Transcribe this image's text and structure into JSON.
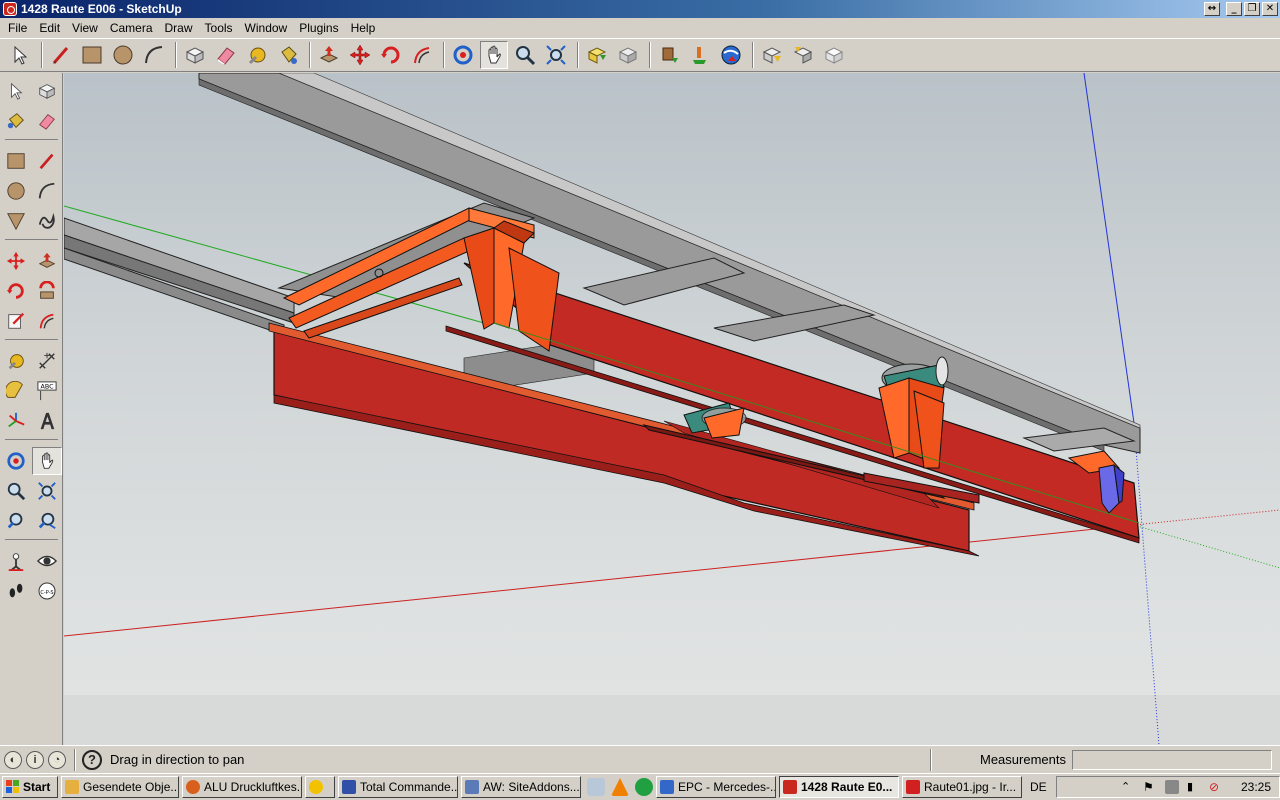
{
  "window": {
    "title": "1428 Raute E006 - SketchUp",
    "app_icon": "sketchup-icon",
    "controls": [
      "restore-icon",
      "minimize-icon",
      "maximize-icon",
      "close-icon"
    ]
  },
  "menu": {
    "items": [
      "File",
      "Edit",
      "View",
      "Camera",
      "Draw",
      "Tools",
      "Window",
      "Plugins",
      "Help"
    ]
  },
  "toolbar": {
    "tools": [
      "select-icon",
      "line-icon",
      "rectangle-icon",
      "circle-icon",
      "arc-icon",
      "make-component-icon",
      "eraser-icon",
      "tape-measure-icon",
      "paint-bucket-icon",
      "push-pull-icon",
      "move-icon",
      "rotate-icon",
      "offset-icon",
      "orbit-icon",
      "pan-icon",
      "zoom-icon",
      "zoom-extents-icon",
      "get-models-icon",
      "share-model-icon",
      "get-components-icon",
      "share-component-icon",
      "google-earth-icon",
      "previous-view-icon",
      "next-view-icon",
      "standard-views-icon"
    ],
    "active_tool": "pan-icon"
  },
  "left_toolbar": {
    "tools": [
      "select-icon",
      "make-component-icon",
      "paint-bucket-icon",
      "eraser-icon",
      "rectangle-icon",
      "line-icon",
      "circle-icon",
      "arc-icon",
      "polygon-icon",
      "freehand-icon",
      "move-icon",
      "push-pull-icon",
      "rotate-icon",
      "follow-me-icon",
      "scale-icon",
      "offset-icon",
      "tape-measure-icon",
      "dimension-icon",
      "protractor-icon",
      "text-icon",
      "axes-icon",
      "3d-text-icon",
      "orbit-icon",
      "pan-icon",
      "zoom-icon",
      "zoom-window-icon",
      "previous-view-icon",
      "zoom-extents-icon",
      "position-camera-icon",
      "look-around-icon",
      "walk-icon",
      "section-plane-icon"
    ],
    "section_text": "ABC",
    "section_label": "C-P-S"
  },
  "statusbar": {
    "icons": [
      "geo-location-icon",
      "credits-icon",
      "user-account-icon"
    ],
    "help_icon": "help-icon",
    "help_glyph": "?",
    "message": "Drag in direction to pan",
    "measurements_label": "Measurements",
    "measurements_value": ""
  },
  "taskbar": {
    "start_label": "Start",
    "tasks": [
      {
        "label": "Gesendete Obje...",
        "icon": "outlook-icon",
        "color": "#e6b040"
      },
      {
        "label": "ALU Druckluftkes...",
        "icon": "firefox-icon",
        "color": "#d8601c"
      },
      {
        "label": "",
        "icon": "norton-icon",
        "color": "#f2c200"
      },
      {
        "label": "Total Commande...",
        "icon": "total-commander-icon",
        "color": "#3050a8"
      },
      {
        "label": "AW: SiteAddons....",
        "icon": "mail-icon",
        "color": "#5a7ab8"
      },
      {
        "label": "",
        "icon": "notepad-icon",
        "color": "#b8c8d8"
      },
      {
        "label": "",
        "icon": "vlc-icon",
        "color": "#f08000"
      },
      {
        "label": "",
        "icon": "skype-icon",
        "color": "#20a040"
      },
      {
        "label": "EPC - Mercedes-...",
        "icon": "epc-icon",
        "color": "#3468c8"
      },
      {
        "label": "1428 Raute E0...",
        "icon": "sketchup-icon",
        "color": "#c8281e",
        "active": true
      },
      {
        "label": "Raute01.jpg - Ir...",
        "icon": "irfanview-icon",
        "color": "#d02020"
      }
    ],
    "language": "DE",
    "tray_icons": [
      "chevron-up-icon",
      "flag-icon",
      "printer-icon",
      "network-icon",
      "speaker-muted-icon"
    ],
    "clock": "23:25"
  },
  "scene": {
    "description_colors": {
      "beam_red": "#c02a24",
      "beam_orange": "#e8541a",
      "steel_gray": "#8e8e8e",
      "roller_teal": "#3a8a7e",
      "bracket_blue": "#6a6ae8"
    }
  }
}
